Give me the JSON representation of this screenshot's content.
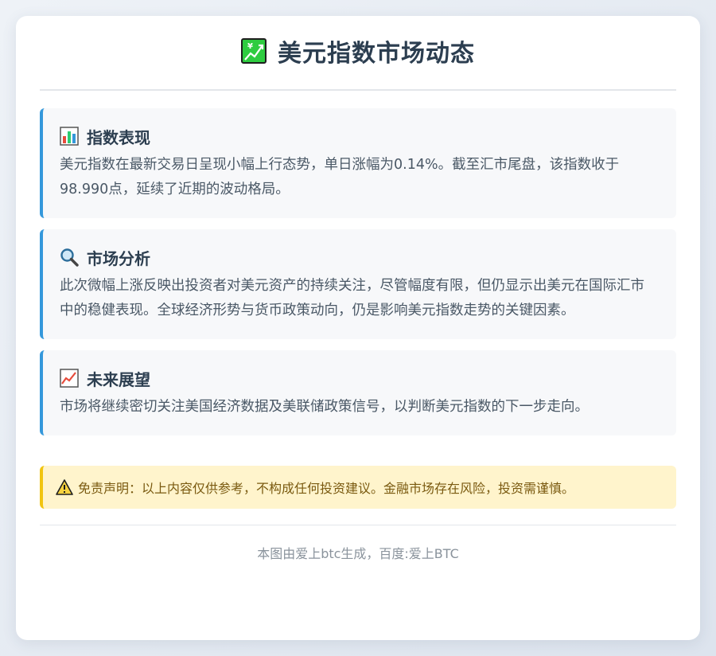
{
  "header": {
    "title": "美元指数市场动态",
    "icon": "chart-increasing-yen-icon"
  },
  "sections": [
    {
      "icon": "bar-chart-icon",
      "title": "指数表现",
      "text": "美元指数在最新交易日呈现小幅上行态势，单日涨幅为0.14%。截至汇市尾盘，该指数收于98.990点，延续了近期的波动格局。"
    },
    {
      "icon": "magnifying-glass-icon",
      "title": "市场分析",
      "text": "此次微幅上涨反映出投资者对美元资产的持续关注，尽管幅度有限，但仍显示出美元在国际汇市中的稳健表现。全球经济形势与货币政策动向，仍是影响美元指数走势的关键因素。"
    },
    {
      "icon": "chart-increasing-icon",
      "title": "未来展望",
      "text": "市场将继续密切关注美国经济数据及美联储政策信号，以判断美元指数的下一步走向。"
    }
  ],
  "disclaimer": {
    "icon": "warning-icon",
    "text": "免责声明：以上内容仅供参考，不构成任何投资建议。金融市场存在风险，投资需谨慎。"
  },
  "footer": {
    "text": "本图由爱上btc生成，百度:爱上BTC"
  },
  "colors": {
    "accent": "#3498db",
    "title": "#2c3e50",
    "warning_border": "#f1c40f",
    "warning_bg": "#fff4cc"
  }
}
